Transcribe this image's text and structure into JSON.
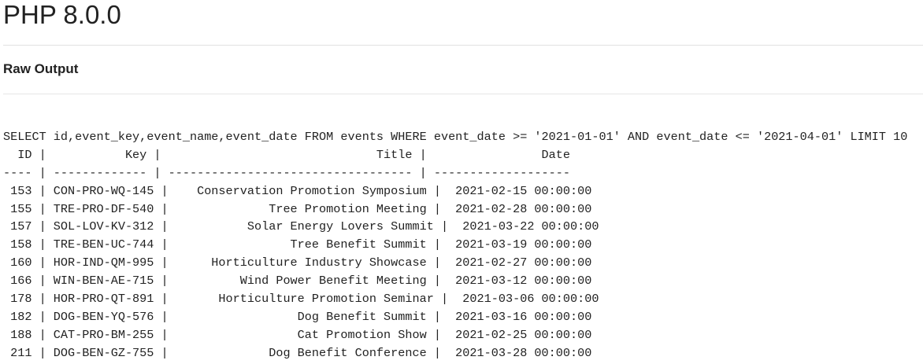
{
  "page": {
    "title": "PHP 8.0.0",
    "section_heading": "Raw Output"
  },
  "output": {
    "query": "SELECT id,event_key,event_name,event_date FROM events WHERE event_date >= '2021-01-01' AND event_date <= '2021-04-01' LIMIT 10",
    "header_line": "  ID |           Key |                              Title |                Date",
    "separator_line": "---- | ------------- | ---------------------------------- | -------------------",
    "rows": [
      " 153 | CON-PRO-WQ-145 |    Conservation Promotion Symposium |  2021-02-15 00:00:00",
      " 155 | TRE-PRO-DF-540 |              Tree Promotion Meeting |  2021-02-28 00:00:00",
      " 157 | SOL-LOV-KV-312 |           Solar Energy Lovers Summit |  2021-03-22 00:00:00",
      " 158 | TRE-BEN-UC-744 |                 Tree Benefit Summit |  2021-03-19 00:00:00",
      " 160 | HOR-IND-QM-995 |      Horticulture Industry Showcase |  2021-02-27 00:00:00",
      " 166 | WIN-BEN-AE-715 |          Wind Power Benefit Meeting |  2021-03-12 00:00:00",
      " 178 | HOR-PRO-QT-891 |       Horticulture Promotion Seminar |  2021-03-06 00:00:00",
      " 182 | DOG-BEN-YQ-576 |                  Dog Benefit Summit |  2021-03-16 00:00:00",
      " 188 | CAT-PRO-BM-255 |                  Cat Promotion Show |  2021-02-25 00:00:00",
      " 211 | DOG-BEN-GZ-755 |              Dog Benefit Conference |  2021-03-28 00:00:00"
    ]
  }
}
